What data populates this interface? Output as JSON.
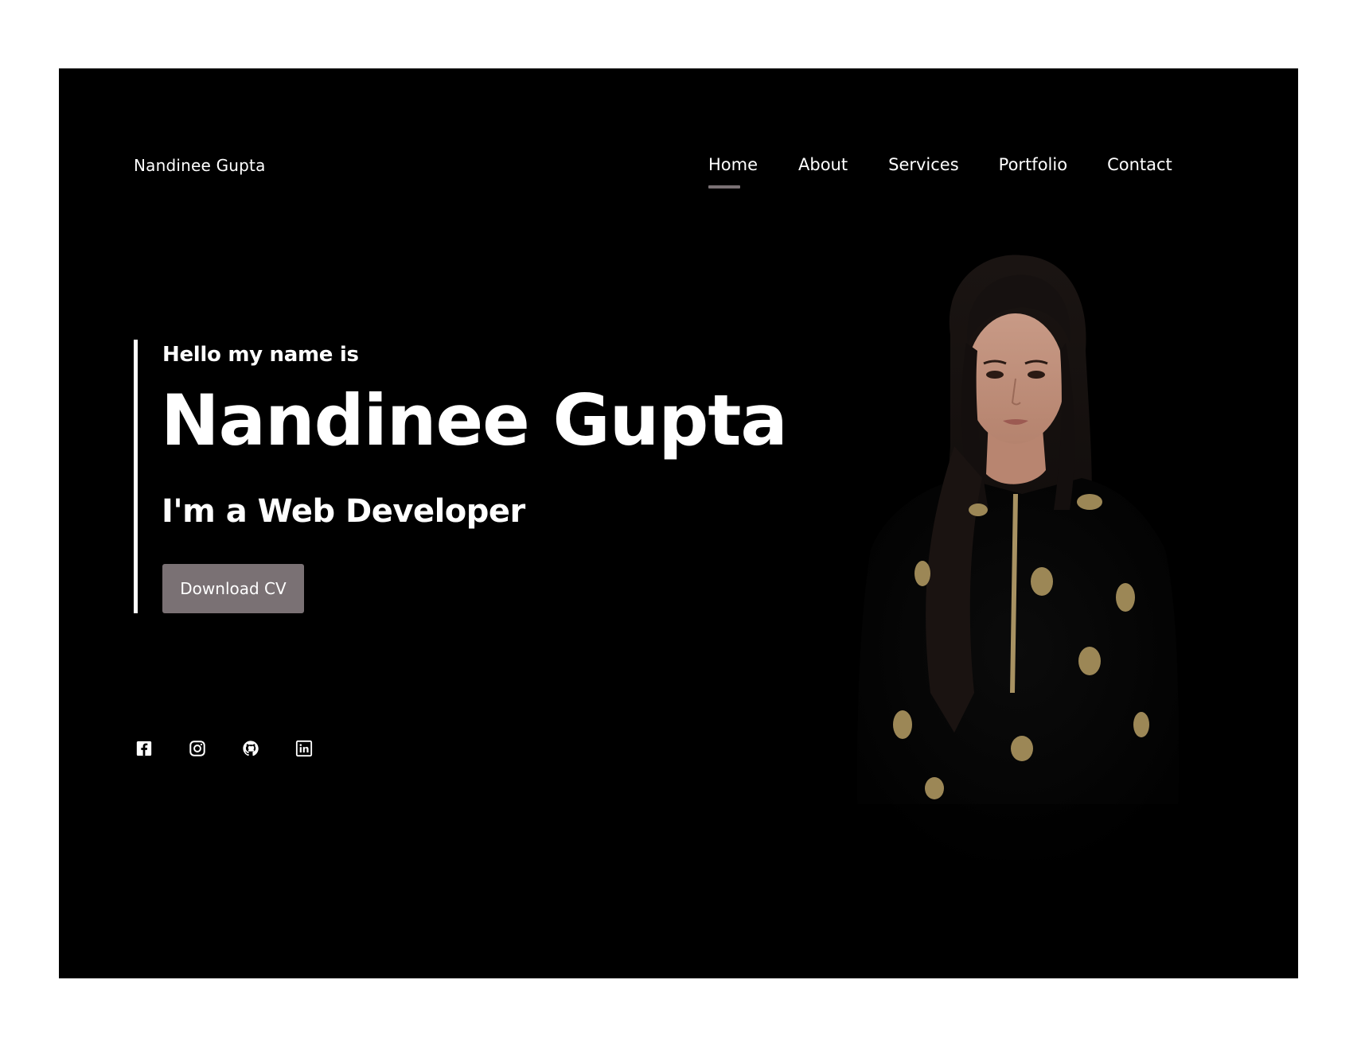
{
  "header": {
    "brand": "Nandinee Gupta",
    "nav": [
      {
        "label": "Home",
        "active": true
      },
      {
        "label": "About"
      },
      {
        "label": "Services"
      },
      {
        "label": "Portfolio"
      },
      {
        "label": "Contact"
      }
    ]
  },
  "hero": {
    "greeting": "Hello my name is",
    "name": "Nandinee Gupta",
    "role": "I'm a Web Developer",
    "cta_label": "Download CV"
  },
  "socials": [
    {
      "icon": "facebook-icon"
    },
    {
      "icon": "instagram-icon"
    },
    {
      "icon": "github-icon"
    },
    {
      "icon": "linkedin-icon"
    }
  ],
  "colors": {
    "background": "#000000",
    "accent": "#7a7174",
    "text": "#ffffff"
  }
}
